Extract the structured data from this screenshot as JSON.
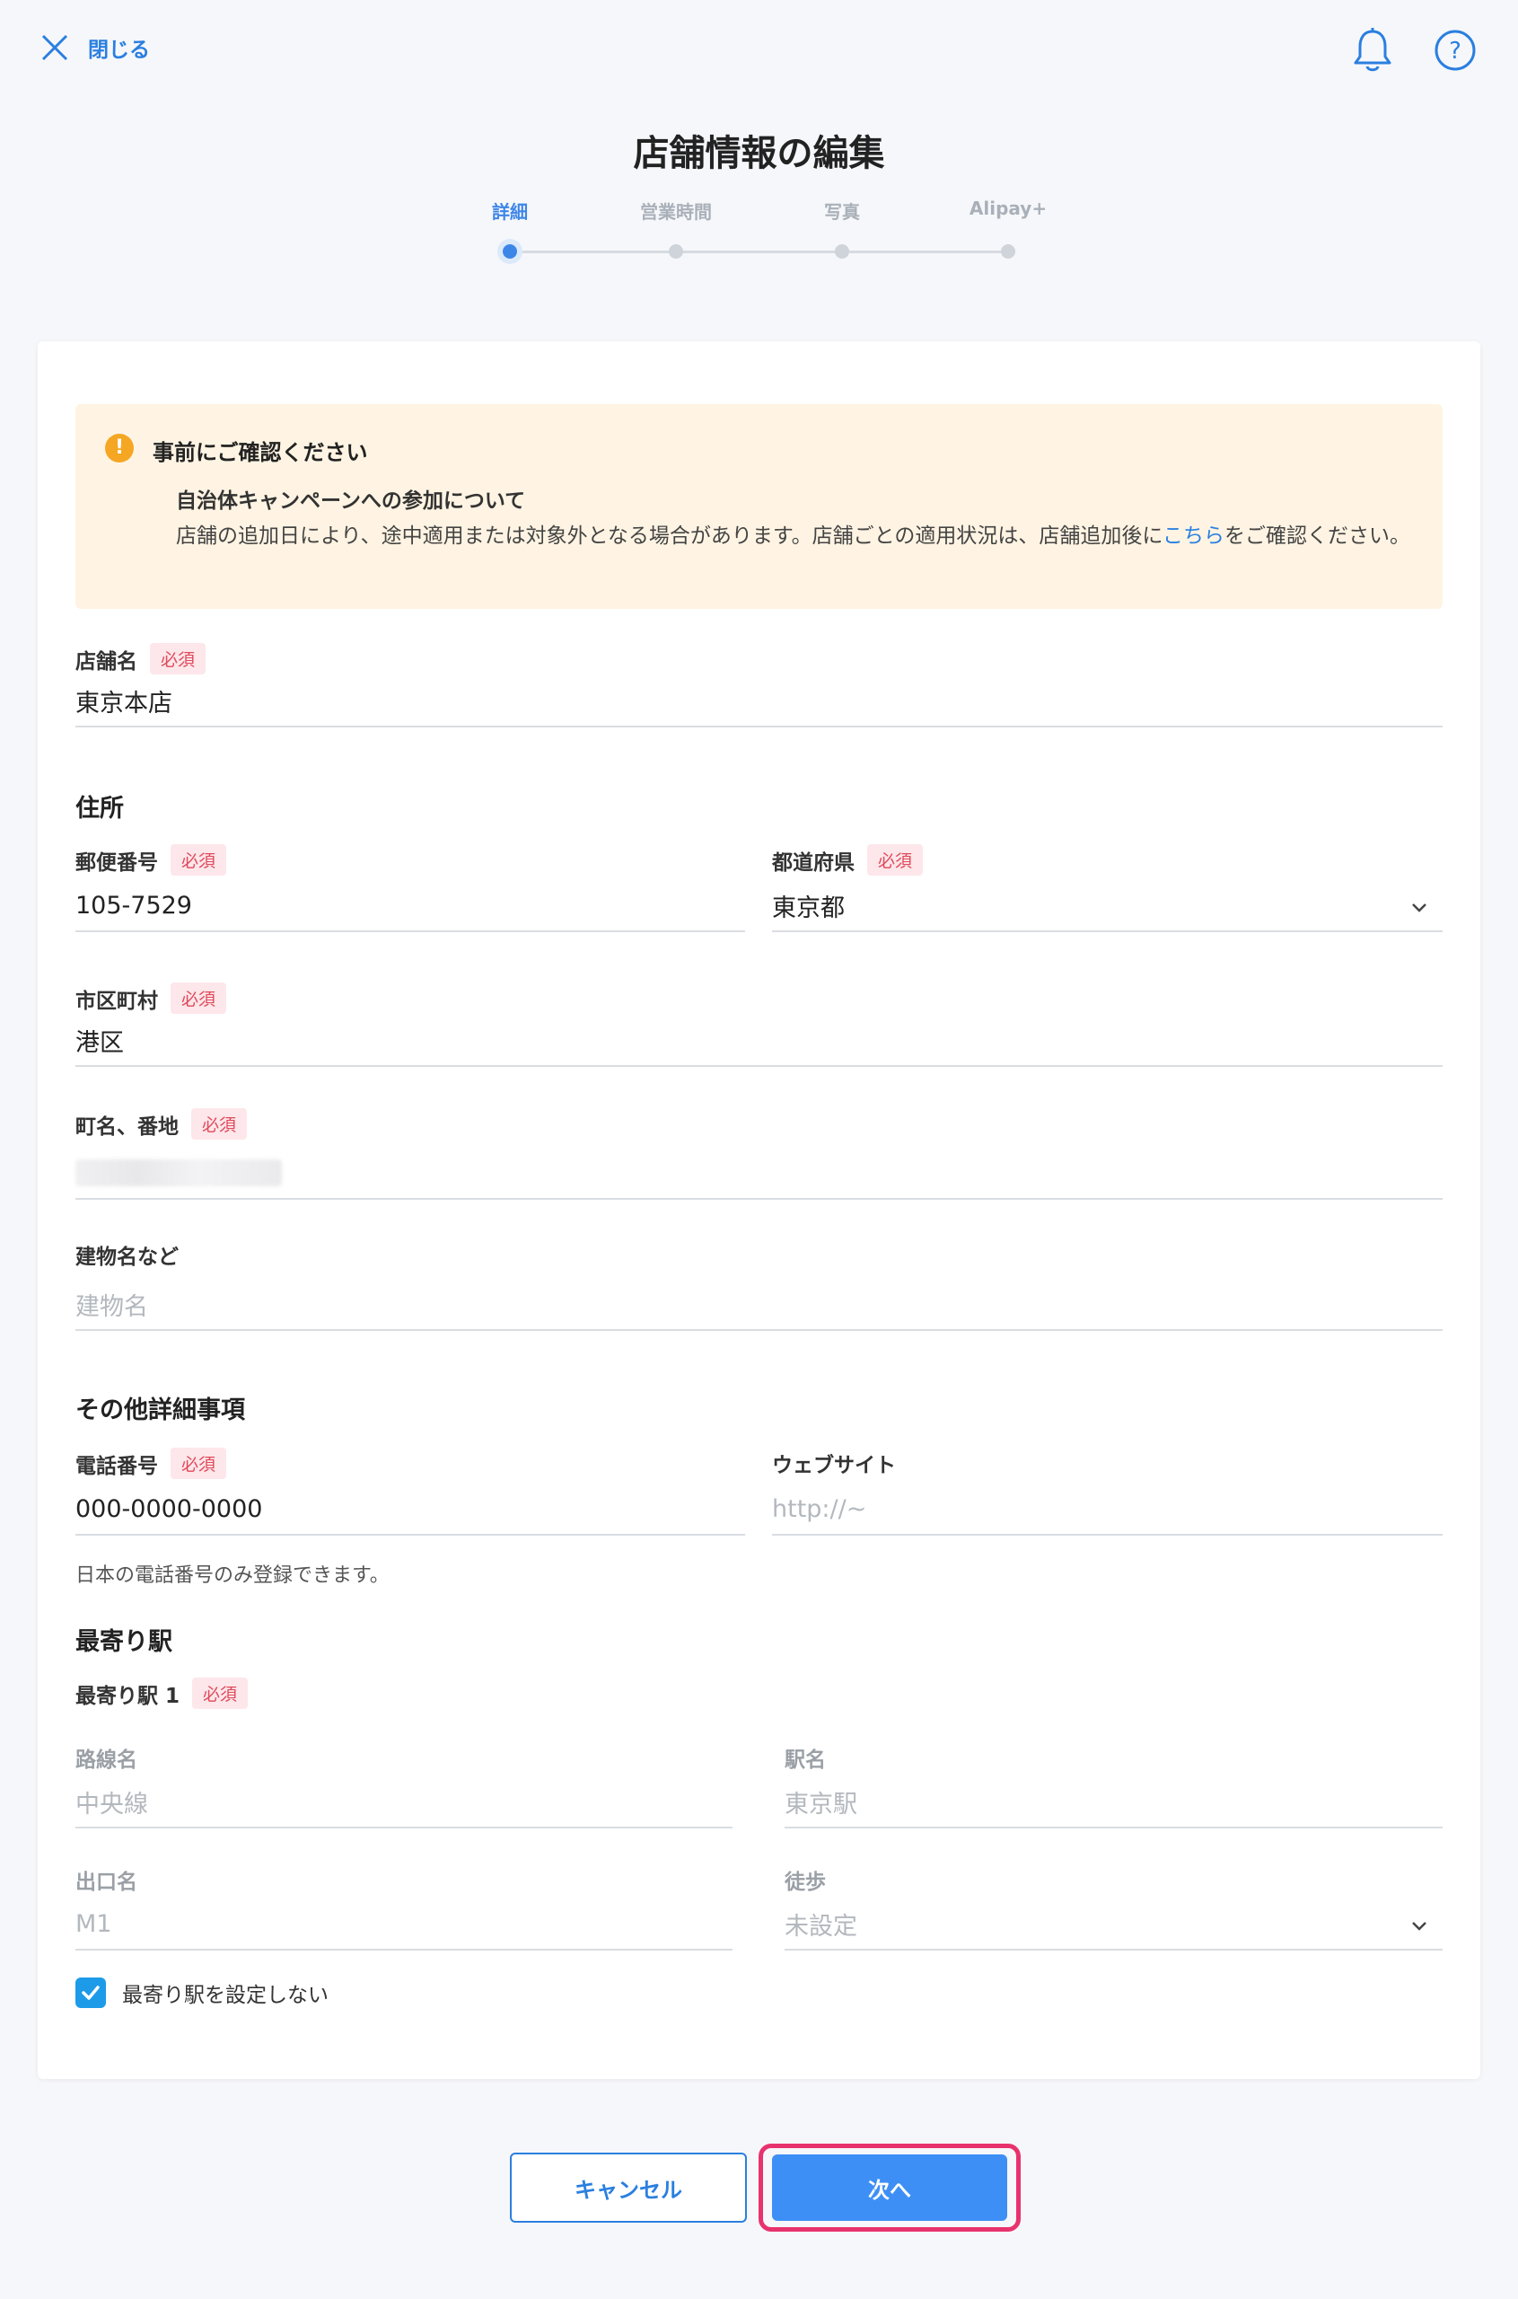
{
  "header": {
    "close_label": "閉じる",
    "icons": [
      "close-icon",
      "bell-icon",
      "help-icon"
    ]
  },
  "page": {
    "title": "店舗情報の編集"
  },
  "stepper": {
    "steps": [
      {
        "label": "詳細",
        "active": true
      },
      {
        "label": "営業時間",
        "active": false
      },
      {
        "label": "写真",
        "active": false
      },
      {
        "label": "Alipay+",
        "active": false
      }
    ]
  },
  "notice": {
    "title": "事前にご確認ください",
    "subtitle": "自治体キャンペーンへの参加について",
    "body_before": "店舗の追加日により、途中適用または対象外となる場合があります。店舗ごとの適用状況は、店舗追加後に",
    "link": "こちら",
    "body_after": "をご確認ください。"
  },
  "required_badge": "必須",
  "form": {
    "store_name": {
      "label": "店舗名",
      "value": "東京本店"
    },
    "address_section": "住所",
    "postal_code": {
      "label": "郵便番号",
      "value": "105-7529"
    },
    "prefecture": {
      "label": "都道府県",
      "value": "東京都"
    },
    "city": {
      "label": "市区町村",
      "value": "港区"
    },
    "street": {
      "label": "町名、番地",
      "value": ""
    },
    "building": {
      "label": "建物名など",
      "placeholder": "建物名"
    },
    "other_section": "その他詳細事項",
    "phone": {
      "label": "電話番号",
      "value": "000-0000-0000",
      "help": "日本の電話番号のみ登録できます。"
    },
    "website": {
      "label": "ウェブサイト",
      "placeholder": "http://~"
    },
    "station_section": "最寄り駅",
    "station1_label": "最寄り駅 1",
    "line_name": {
      "label": "路線名",
      "placeholder": "中央線"
    },
    "station_name": {
      "label": "駅名",
      "placeholder": "東京駅"
    },
    "exit_name": {
      "label": "出口名",
      "placeholder": "M1"
    },
    "walk": {
      "label": "徒歩",
      "placeholder": "未設定"
    },
    "no_station": {
      "label": "最寄り駅を設定しない",
      "checked": true
    }
  },
  "actions": {
    "cancel": "キャンセル",
    "next": "次へ"
  },
  "colors": {
    "accent": "#2a7fe0",
    "primary_button": "#3d8ff5",
    "highlight": "#e8326e",
    "notice_bg": "#fff4e3",
    "required": "#e04a5c"
  }
}
